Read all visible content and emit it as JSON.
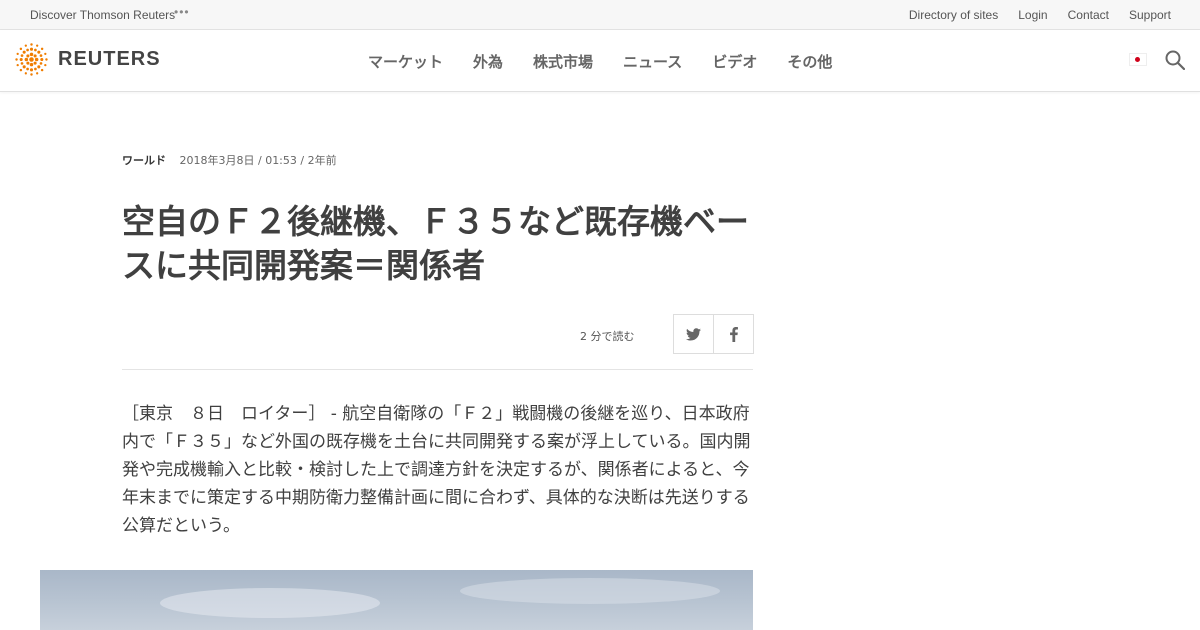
{
  "utility_bar": {
    "discover": "Discover Thomson Reuters",
    "links": [
      "Directory of sites",
      "Login",
      "Contact",
      "Support"
    ]
  },
  "header": {
    "brand": "REUTERS",
    "nav": [
      "マーケット",
      "外為",
      "株式市場",
      "ニュース",
      "ビデオ",
      "その他"
    ],
    "icons": {
      "logo": "reuters-dot-logo",
      "flag": "japan-flag-icon",
      "search": "search-icon"
    },
    "colors": {
      "logo_orange": "#f07d00",
      "flag_red": "#d0021b"
    }
  },
  "article": {
    "category": "ワールド",
    "dateline": "2018年3月8日 / 01:53 / 2年前",
    "title": "空自のＦ２後継機、Ｆ３５など既存機ベースに共同開発案＝関係者",
    "read_time": "2 分で読む",
    "share_icons": [
      "twitter-icon",
      "facebook-icon"
    ],
    "body": "［東京　８日　ロイター］ - 航空自衛隊の「Ｆ２」戦闘機の後継を巡り、日本政府内で「Ｆ３５」など外国の既存機を土台に共同開発する案が浮上している。国内開発や完成機輸入と比較・検討した上で調達方針を決定するが、関係者によると、今年末までに策定する中期防衛力整備計画に間に合わず、具体的な決断は先送りする公算だという。"
  }
}
